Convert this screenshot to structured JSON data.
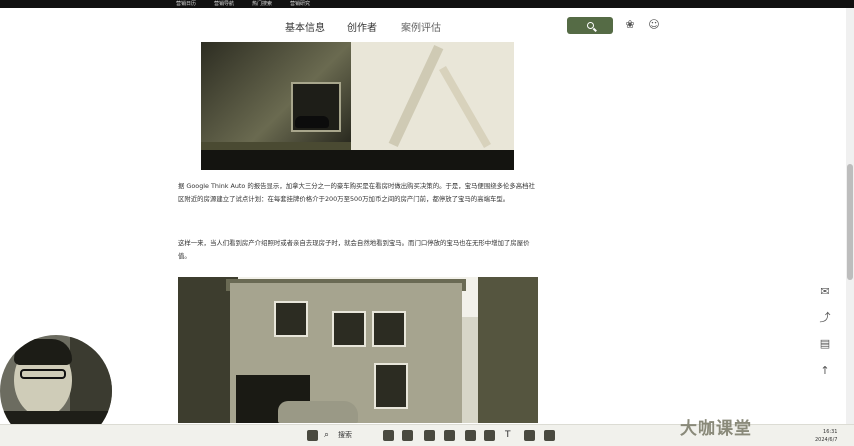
{
  "topbar": {
    "links": [
      "营销日历",
      "营销导航",
      "热门搜索",
      "营销研究"
    ]
  },
  "nav": {
    "tabs": [
      "基本信息",
      "创作者",
      "案例评估"
    ]
  },
  "article": {
    "p1": "据 Google Think Auto 的报告显示，加拿大三分之一的豪车购买是在看房时做出购买决策的。于是，宝马便围绕多伦多高档社区附近的房源建立了试点计划：在每套挂牌价格介于200万至500万加币之间的房产门前，都停放了宝马的高端车型。",
    "p2": "这样一来，当人们看到房产介绍照时或者亲自去现房子时，就会自然地看到宝马。而门口停放的宝马也在无形中增加了房屋价值。"
  },
  "watermark": "大咖课堂",
  "taskbar": {
    "search_label": "搜索",
    "time": "16:31",
    "date": "2024/6/7"
  }
}
